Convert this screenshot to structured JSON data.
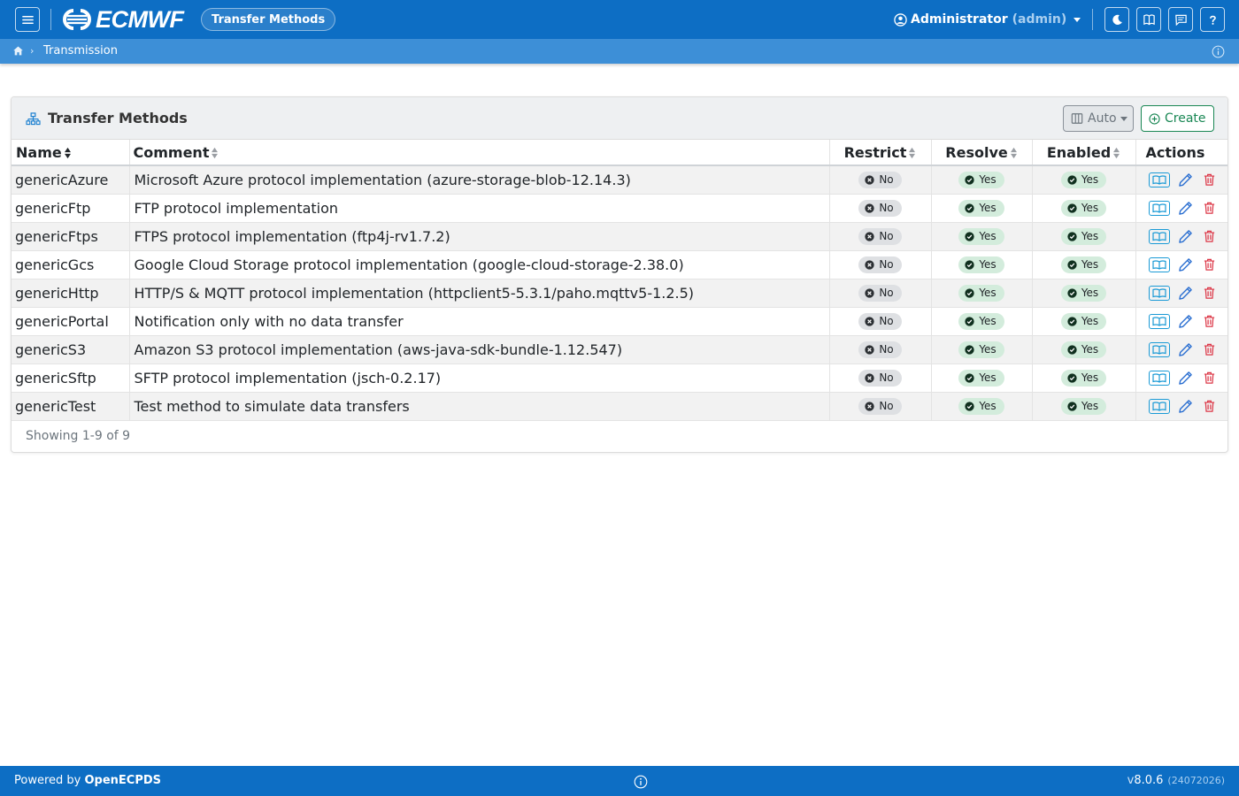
{
  "brand": {
    "name": "ECMWF"
  },
  "navbar": {
    "page_title": "Transfer Methods",
    "user_name": "Administrator",
    "user_login": "(admin)"
  },
  "breadcrumb": {
    "items": [
      "Transmission"
    ]
  },
  "card": {
    "title": "Transfer Methods",
    "auto_label": "Auto",
    "create_label": "Create",
    "footer_text": "Showing 1-9 of 9"
  },
  "table": {
    "columns": [
      "Name",
      "Comment",
      "Restrict",
      "Resolve",
      "Enabled",
      "Actions"
    ],
    "rows": [
      {
        "name": "genericAzure",
        "comment": "Microsoft Azure protocol implementation (azure-storage-blob-12.14.3)",
        "restrict": "No",
        "resolve": "Yes",
        "enabled": "Yes"
      },
      {
        "name": "genericFtp",
        "comment": "FTP protocol implementation",
        "restrict": "No",
        "resolve": "Yes",
        "enabled": "Yes"
      },
      {
        "name": "genericFtps",
        "comment": "FTPS protocol implementation (ftp4j-rv1.7.2)",
        "restrict": "No",
        "resolve": "Yes",
        "enabled": "Yes"
      },
      {
        "name": "genericGcs",
        "comment": "Google Cloud Storage protocol implementation (google-cloud-storage-2.38.0)",
        "restrict": "No",
        "resolve": "Yes",
        "enabled": "Yes"
      },
      {
        "name": "genericHttp",
        "comment": "HTTP/S & MQTT protocol implementation (httpclient5-5.3.1/paho.mqttv5-1.2.5)",
        "restrict": "No",
        "resolve": "Yes",
        "enabled": "Yes"
      },
      {
        "name": "genericPortal",
        "comment": "Notification only with no data transfer",
        "restrict": "No",
        "resolve": "Yes",
        "enabled": "Yes"
      },
      {
        "name": "genericS3",
        "comment": "Amazon S3 protocol implementation (aws-java-sdk-bundle-1.12.547)",
        "restrict": "No",
        "resolve": "Yes",
        "enabled": "Yes"
      },
      {
        "name": "genericSftp",
        "comment": "SFTP protocol implementation (jsch-0.2.17)",
        "restrict": "No",
        "resolve": "Yes",
        "enabled": "Yes"
      },
      {
        "name": "genericTest",
        "comment": "Test method to simulate data transfers",
        "restrict": "No",
        "resolve": "Yes",
        "enabled": "Yes"
      }
    ]
  },
  "footer": {
    "powered_prefix": "Powered by",
    "powered_name": "OpenECPDS",
    "version_prefix": "v",
    "version": "8.0.6",
    "build": "(24072026)"
  },
  "icons": {
    "menu": "hamburger-menu-icon",
    "theme": "moon-icon",
    "docs": "book-icon",
    "messages": "message-icon",
    "help": "question-icon"
  },
  "colors": {
    "primary": "#0d6ec4",
    "crumb": "#3d8fd7",
    "success": "#198754",
    "danger": "#dc3545",
    "edit": "#2b6fd1",
    "view": "#1a9ad6"
  }
}
